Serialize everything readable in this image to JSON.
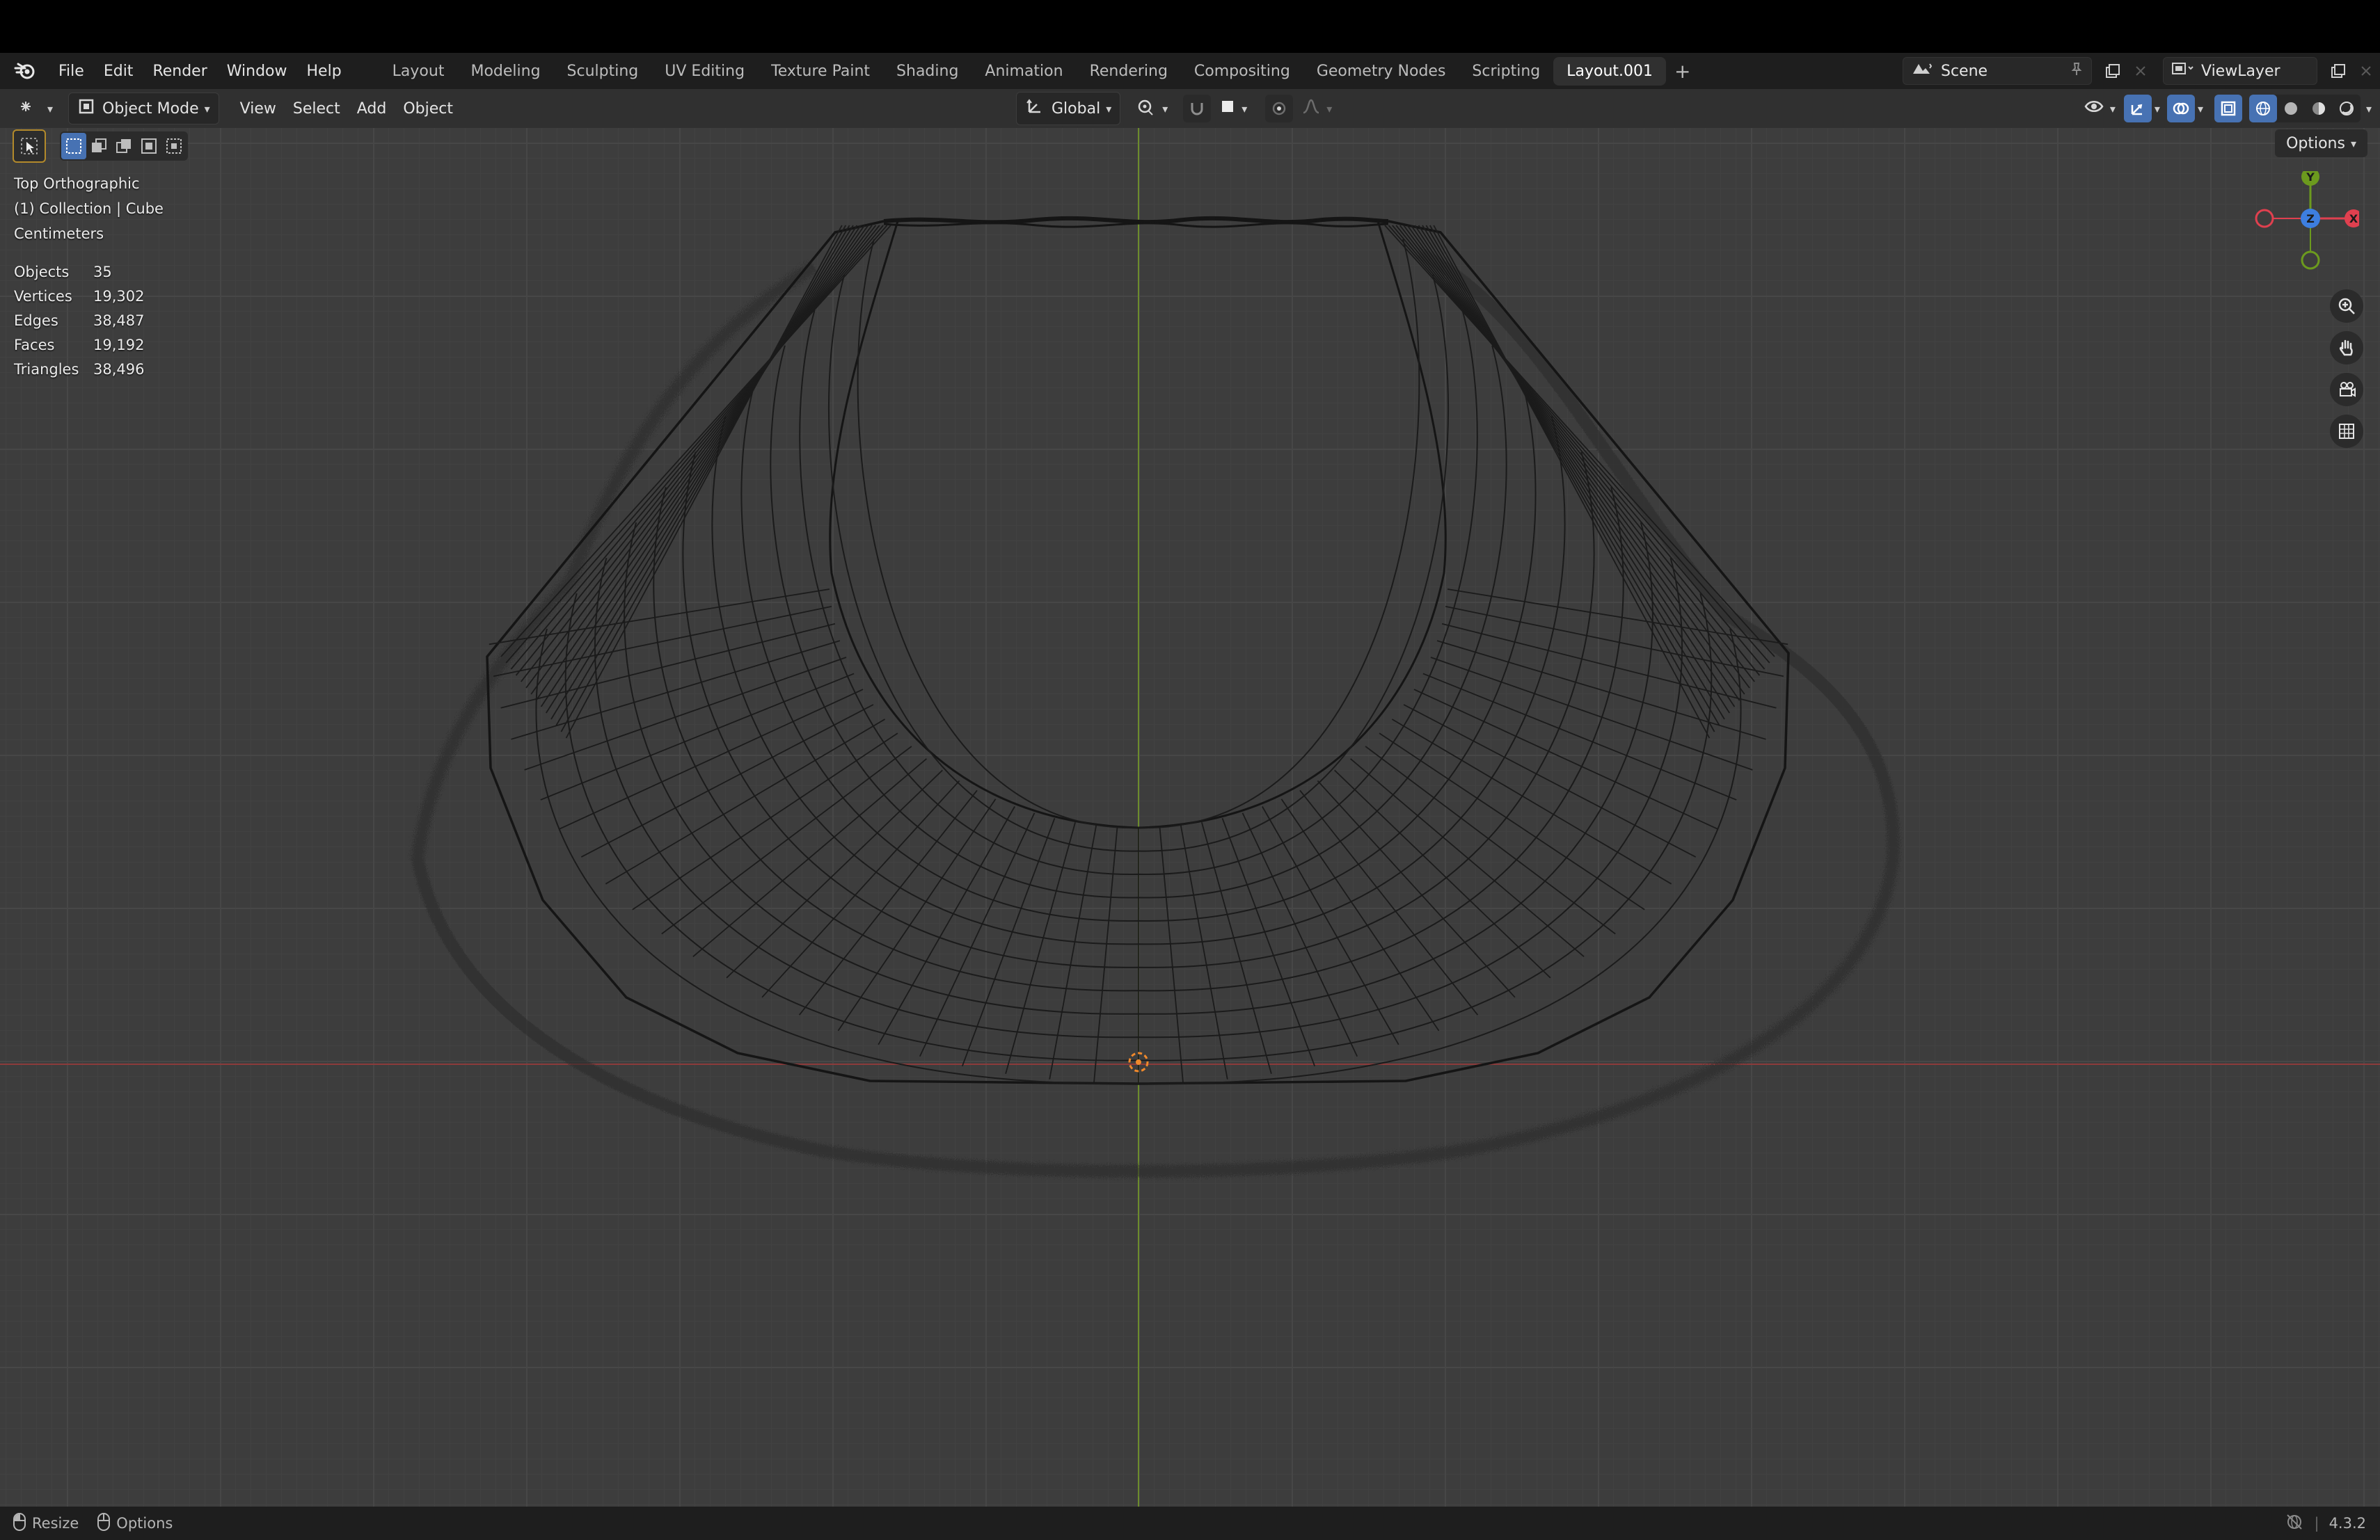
{
  "menu": [
    "File",
    "Edit",
    "Render",
    "Window",
    "Help"
  ],
  "workspaces": [
    {
      "label": "Layout",
      "active": false
    },
    {
      "label": "Modeling",
      "active": false
    },
    {
      "label": "Sculpting",
      "active": false
    },
    {
      "label": "UV Editing",
      "active": false
    },
    {
      "label": "Texture Paint",
      "active": false
    },
    {
      "label": "Shading",
      "active": false
    },
    {
      "label": "Animation",
      "active": false
    },
    {
      "label": "Rendering",
      "active": false
    },
    {
      "label": "Compositing",
      "active": false
    },
    {
      "label": "Geometry Nodes",
      "active": false
    },
    {
      "label": "Scripting",
      "active": false
    },
    {
      "label": "Layout.001",
      "active": true
    }
  ],
  "workspace_add": "+",
  "scene": {
    "name": "Scene"
  },
  "view_layer": {
    "name": "ViewLayer"
  },
  "header": {
    "mode": "Object Mode",
    "menus": [
      "View",
      "Select",
      "Add",
      "Object"
    ],
    "transform_orientation": "Global"
  },
  "viewport": {
    "options_label": "Options",
    "view_name": "Top Orthographic",
    "collection_line": "(1) Collection | Cube",
    "units": "Centimeters",
    "stats": [
      {
        "label": "Objects",
        "value": "35"
      },
      {
        "label": "Vertices",
        "value": "19,302"
      },
      {
        "label": "Edges",
        "value": "38,487"
      },
      {
        "label": "Faces",
        "value": "19,192"
      },
      {
        "label": "Triangles",
        "value": "38,496"
      }
    ],
    "gizmo": {
      "y": "Y",
      "z": "Z",
      "x": "X"
    }
  },
  "colors": {
    "x_axis": "#e0404f",
    "y_axis": "#6c9a1e",
    "z_axis": "#3d7ee0",
    "accent": "#4772b3"
  },
  "statusbar": {
    "resize": "Resize",
    "options": "Options",
    "version": "4.3.2"
  }
}
